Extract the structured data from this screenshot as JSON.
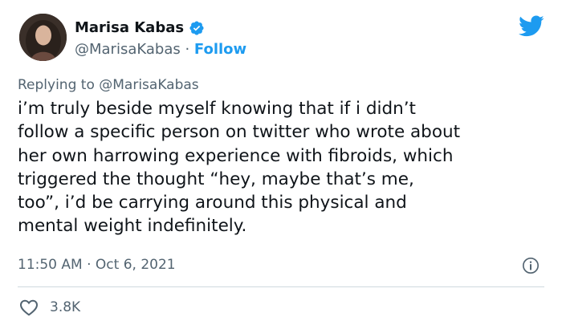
{
  "author": {
    "display_name": "Marisa Kabas",
    "handle": "@MarisaKabas",
    "separator": " · ",
    "follow_label": "Follow",
    "verified": true
  },
  "reply": {
    "prefix": "Replying to ",
    "mention": "@MarisaKabas"
  },
  "tweet": {
    "text": "i’m truly beside myself knowing that if i didn’t\nfollow a specific person on twitter who wrote about\nher own harrowing experience with fibroids, which\ntriggered the thought “hey, maybe that’s me,\ntoo”, i’d be carrying around this physical and\nmental weight indefinitely."
  },
  "meta": {
    "time": "11:50 AM",
    "separator": " · ",
    "date": "Oct 6, 2021"
  },
  "engagement": {
    "likes": "3.8K"
  },
  "icons": {
    "brand": "twitter-bird-icon",
    "verified": "verified-badge-icon",
    "info": "info-icon",
    "like": "heart-icon"
  },
  "colors": {
    "brand_blue": "#1d9bf0",
    "secondary_text": "#536471",
    "primary_text": "#0f1419",
    "divider": "#cfd9de"
  }
}
